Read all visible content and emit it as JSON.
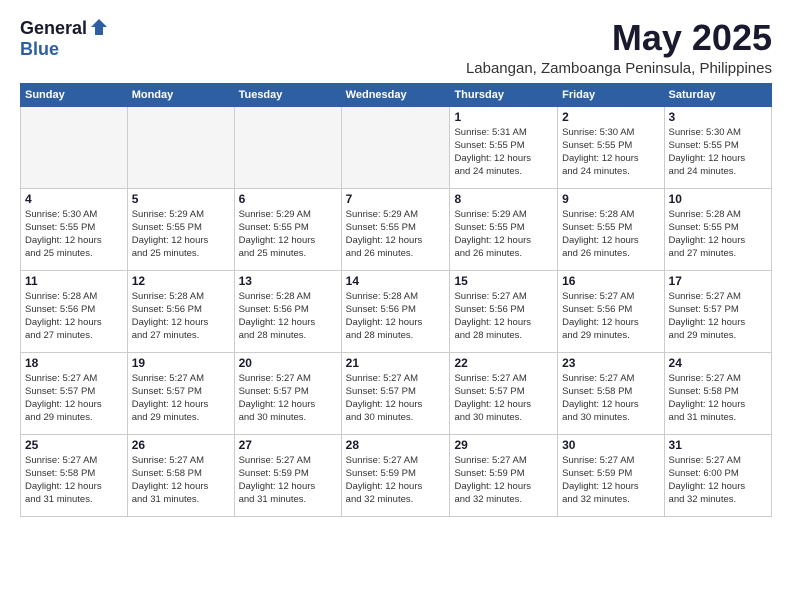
{
  "logo": {
    "general": "General",
    "blue": "Blue"
  },
  "title": "May 2025",
  "location": "Labangan, Zamboanga Peninsula, Philippines",
  "weekdays": [
    "Sunday",
    "Monday",
    "Tuesday",
    "Wednesday",
    "Thursday",
    "Friday",
    "Saturday"
  ],
  "weeks": [
    [
      {
        "day": "",
        "info": ""
      },
      {
        "day": "",
        "info": ""
      },
      {
        "day": "",
        "info": ""
      },
      {
        "day": "",
        "info": ""
      },
      {
        "day": "1",
        "info": "Sunrise: 5:31 AM\nSunset: 5:55 PM\nDaylight: 12 hours\nand 24 minutes."
      },
      {
        "day": "2",
        "info": "Sunrise: 5:30 AM\nSunset: 5:55 PM\nDaylight: 12 hours\nand 24 minutes."
      },
      {
        "day": "3",
        "info": "Sunrise: 5:30 AM\nSunset: 5:55 PM\nDaylight: 12 hours\nand 24 minutes."
      }
    ],
    [
      {
        "day": "4",
        "info": "Sunrise: 5:30 AM\nSunset: 5:55 PM\nDaylight: 12 hours\nand 25 minutes."
      },
      {
        "day": "5",
        "info": "Sunrise: 5:29 AM\nSunset: 5:55 PM\nDaylight: 12 hours\nand 25 minutes."
      },
      {
        "day": "6",
        "info": "Sunrise: 5:29 AM\nSunset: 5:55 PM\nDaylight: 12 hours\nand 25 minutes."
      },
      {
        "day": "7",
        "info": "Sunrise: 5:29 AM\nSunset: 5:55 PM\nDaylight: 12 hours\nand 26 minutes."
      },
      {
        "day": "8",
        "info": "Sunrise: 5:29 AM\nSunset: 5:55 PM\nDaylight: 12 hours\nand 26 minutes."
      },
      {
        "day": "9",
        "info": "Sunrise: 5:28 AM\nSunset: 5:55 PM\nDaylight: 12 hours\nand 26 minutes."
      },
      {
        "day": "10",
        "info": "Sunrise: 5:28 AM\nSunset: 5:55 PM\nDaylight: 12 hours\nand 27 minutes."
      }
    ],
    [
      {
        "day": "11",
        "info": "Sunrise: 5:28 AM\nSunset: 5:56 PM\nDaylight: 12 hours\nand 27 minutes."
      },
      {
        "day": "12",
        "info": "Sunrise: 5:28 AM\nSunset: 5:56 PM\nDaylight: 12 hours\nand 27 minutes."
      },
      {
        "day": "13",
        "info": "Sunrise: 5:28 AM\nSunset: 5:56 PM\nDaylight: 12 hours\nand 28 minutes."
      },
      {
        "day": "14",
        "info": "Sunrise: 5:28 AM\nSunset: 5:56 PM\nDaylight: 12 hours\nand 28 minutes."
      },
      {
        "day": "15",
        "info": "Sunrise: 5:27 AM\nSunset: 5:56 PM\nDaylight: 12 hours\nand 28 minutes."
      },
      {
        "day": "16",
        "info": "Sunrise: 5:27 AM\nSunset: 5:56 PM\nDaylight: 12 hours\nand 29 minutes."
      },
      {
        "day": "17",
        "info": "Sunrise: 5:27 AM\nSunset: 5:57 PM\nDaylight: 12 hours\nand 29 minutes."
      }
    ],
    [
      {
        "day": "18",
        "info": "Sunrise: 5:27 AM\nSunset: 5:57 PM\nDaylight: 12 hours\nand 29 minutes."
      },
      {
        "day": "19",
        "info": "Sunrise: 5:27 AM\nSunset: 5:57 PM\nDaylight: 12 hours\nand 29 minutes."
      },
      {
        "day": "20",
        "info": "Sunrise: 5:27 AM\nSunset: 5:57 PM\nDaylight: 12 hours\nand 30 minutes."
      },
      {
        "day": "21",
        "info": "Sunrise: 5:27 AM\nSunset: 5:57 PM\nDaylight: 12 hours\nand 30 minutes."
      },
      {
        "day": "22",
        "info": "Sunrise: 5:27 AM\nSunset: 5:57 PM\nDaylight: 12 hours\nand 30 minutes."
      },
      {
        "day": "23",
        "info": "Sunrise: 5:27 AM\nSunset: 5:58 PM\nDaylight: 12 hours\nand 30 minutes."
      },
      {
        "day": "24",
        "info": "Sunrise: 5:27 AM\nSunset: 5:58 PM\nDaylight: 12 hours\nand 31 minutes."
      }
    ],
    [
      {
        "day": "25",
        "info": "Sunrise: 5:27 AM\nSunset: 5:58 PM\nDaylight: 12 hours\nand 31 minutes."
      },
      {
        "day": "26",
        "info": "Sunrise: 5:27 AM\nSunset: 5:58 PM\nDaylight: 12 hours\nand 31 minutes."
      },
      {
        "day": "27",
        "info": "Sunrise: 5:27 AM\nSunset: 5:59 PM\nDaylight: 12 hours\nand 31 minutes."
      },
      {
        "day": "28",
        "info": "Sunrise: 5:27 AM\nSunset: 5:59 PM\nDaylight: 12 hours\nand 32 minutes."
      },
      {
        "day": "29",
        "info": "Sunrise: 5:27 AM\nSunset: 5:59 PM\nDaylight: 12 hours\nand 32 minutes."
      },
      {
        "day": "30",
        "info": "Sunrise: 5:27 AM\nSunset: 5:59 PM\nDaylight: 12 hours\nand 32 minutes."
      },
      {
        "day": "31",
        "info": "Sunrise: 5:27 AM\nSunset: 6:00 PM\nDaylight: 12 hours\nand 32 minutes."
      }
    ]
  ]
}
